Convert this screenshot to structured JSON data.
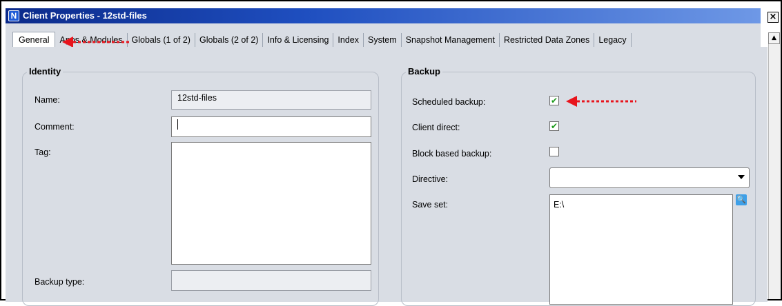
{
  "window": {
    "title": "Client Properties - 12std-files",
    "logo_letter": "N",
    "close_glyph": "×"
  },
  "tabs": [
    {
      "label": "General",
      "active": true
    },
    {
      "label": "Apps & Modules"
    },
    {
      "label": "Globals (1 of 2)"
    },
    {
      "label": "Globals (2 of 2)"
    },
    {
      "label": "Info & Licensing"
    },
    {
      "label": "Index"
    },
    {
      "label": "System"
    },
    {
      "label": "Snapshot Management"
    },
    {
      "label": "Restricted Data Zones"
    },
    {
      "label": "Legacy"
    }
  ],
  "identity": {
    "group_label": "Identity",
    "name_label": "Name:",
    "name_value": "12std-files",
    "comment_label": "Comment:",
    "comment_value": "",
    "tag_label": "Tag:",
    "tag_value": "",
    "backup_type_label": "Backup type:",
    "backup_type_value": ""
  },
  "backup": {
    "group_label": "Backup",
    "scheduled_label": "Scheduled backup:",
    "scheduled_checked": true,
    "client_direct_label": "Client direct:",
    "client_direct_checked": true,
    "block_based_label": "Block based backup:",
    "block_based_checked": false,
    "directive_label": "Directive:",
    "directive_value": "",
    "saveset_label": "Save set:",
    "saveset_value": "E:\\"
  },
  "colors": {
    "annotation_arrow": "#e8141c",
    "check_green": "#1a9a1a",
    "title_bar": "#1f4fc0"
  },
  "icons": {
    "search": "magnifier-icon",
    "dropdown": "chevron-down-icon"
  }
}
